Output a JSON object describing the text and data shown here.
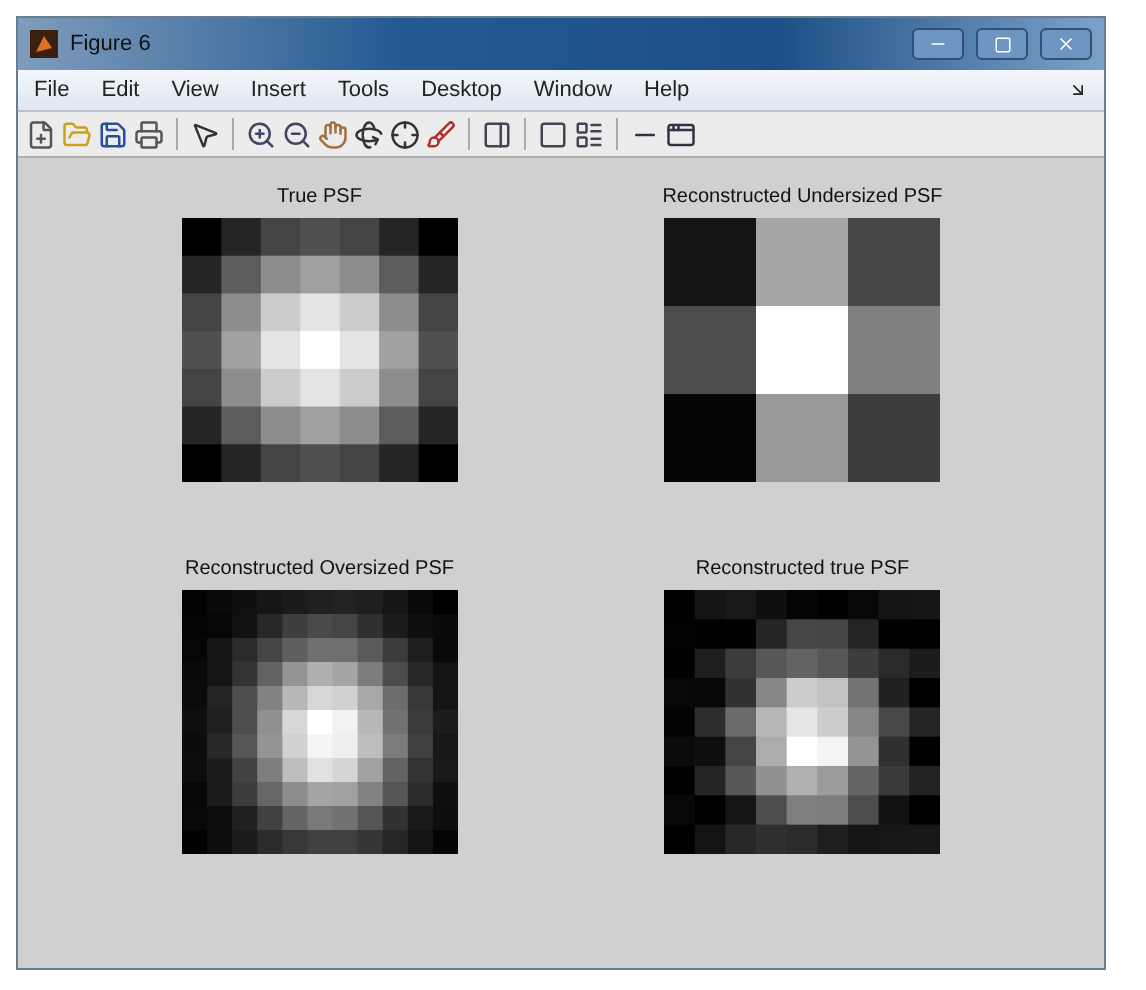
{
  "window": {
    "title": "Figure 6"
  },
  "menu": [
    "File",
    "Edit",
    "View",
    "Insert",
    "Tools",
    "Desktop",
    "Window",
    "Help"
  ],
  "plots": [
    {
      "title": "True PSF",
      "kind": "true"
    },
    {
      "title": "Reconstructed Undersized PSF",
      "kind": "under"
    },
    {
      "title": "Reconstructed Oversized PSF",
      "kind": "over"
    },
    {
      "title": "Reconstructed true PSF",
      "kind": "recon"
    }
  ]
}
